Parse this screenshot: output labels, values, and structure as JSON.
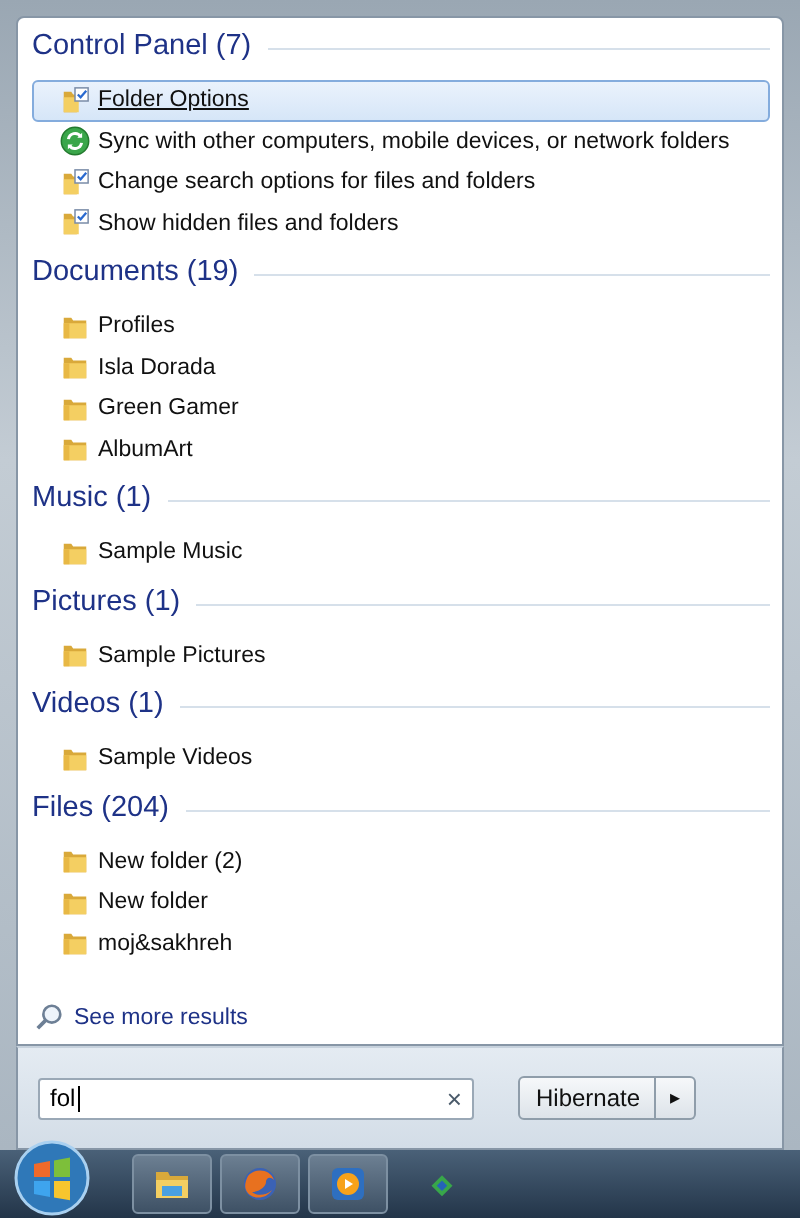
{
  "groups": [
    {
      "title": "Control Panel (7)",
      "items": [
        {
          "label": "Folder Options",
          "kind": "control-panel",
          "selected": true
        },
        {
          "label": "Sync with other computers, mobile devices, or network folders",
          "kind": "sync",
          "selected": false
        },
        {
          "label": "Change search options for files and folders",
          "kind": "control-panel",
          "selected": false
        },
        {
          "label": "Show hidden files and folders",
          "kind": "control-panel",
          "selected": false
        }
      ]
    },
    {
      "title": "Documents (19)",
      "items": [
        {
          "label": "Profiles",
          "kind": "folder",
          "selected": false
        },
        {
          "label": "Isla Dorada",
          "kind": "folder",
          "selected": false
        },
        {
          "label": "Green Gamer",
          "kind": "folder",
          "selected": false
        },
        {
          "label": "AlbumArt",
          "kind": "folder",
          "selected": false
        }
      ]
    },
    {
      "title": "Music (1)",
      "items": [
        {
          "label": "Sample Music",
          "kind": "folder",
          "selected": false
        }
      ]
    },
    {
      "title": "Pictures (1)",
      "items": [
        {
          "label": "Sample Pictures",
          "kind": "folder",
          "selected": false
        }
      ]
    },
    {
      "title": "Videos (1)",
      "items": [
        {
          "label": "Sample Videos",
          "kind": "folder",
          "selected": false
        }
      ]
    },
    {
      "title": "Files (204)",
      "items": [
        {
          "label": "New folder (2)",
          "kind": "folder",
          "selected": false
        },
        {
          "label": "New folder",
          "kind": "folder",
          "selected": false
        },
        {
          "label": "moj&sakhreh",
          "kind": "folder",
          "selected": false
        }
      ]
    }
  ],
  "see_more": "See more results",
  "search": {
    "value": "fol",
    "clear": "×"
  },
  "power": {
    "label": "Hibernate",
    "arrow": "▸"
  }
}
